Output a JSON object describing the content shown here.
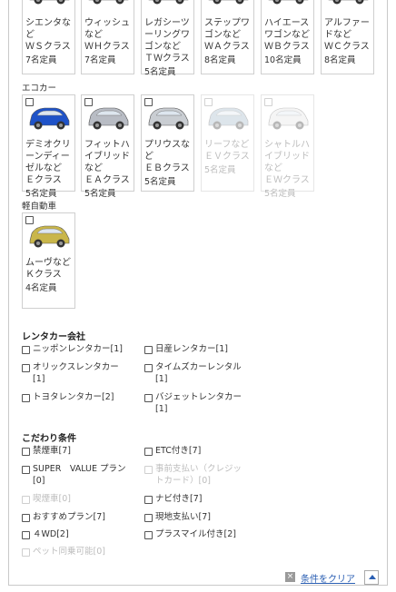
{
  "cards_row1": [
    {
      "text": "シエンタな\nど\nＷＳクラス",
      "cap": "7名定員",
      "color": "#e8e8e8"
    },
    {
      "text": "ウィッシュ\nなど\nＷＨクラス",
      "cap": "7名定員",
      "color": "#e8e8e8"
    },
    {
      "text": "レガシーツ\nーリングワ\nゴンなど\nＴＷクラス",
      "cap": "5名定員",
      "color": "#e8e8e8"
    },
    {
      "text": "ステップワ\nゴンなど\nＷＡクラス",
      "cap": "8名定員",
      "color": "#e8e8e8"
    },
    {
      "text": "ハイエース\nワゴンなど\nＷＢクラス",
      "cap": "10名定員",
      "color": "#e8e8e8"
    },
    {
      "text": "アルファー\nドなど\nＷＣクラス",
      "cap": "8名定員",
      "color": "#e8e8e8"
    }
  ],
  "eco": {
    "label": "エコカー",
    "cards": [
      {
        "text": "デミオクリ\nーンディー\nゼルなど\nＥクラス",
        "cap": "5名定員",
        "color": "#1f53c8",
        "disabled": false
      },
      {
        "text": "フィットハ\nイブリッド\nなど\nＥＡクラス",
        "cap": "5名定員",
        "color": "#b8bcc4",
        "disabled": false
      },
      {
        "text": "プリウスな\nど\nＥＢクラス",
        "cap": "5名定員",
        "color": "#c9cdd2",
        "disabled": false
      },
      {
        "text": "リーフなど\nＥＶクラス",
        "cap": "5名定員",
        "color": "#9fb6c8",
        "disabled": true
      },
      {
        "text": "シャトルハ\nイブリッド\nなど\nＥＷクラス",
        "cap": "5名定員",
        "color": "#e4e4e4",
        "disabled": true
      }
    ]
  },
  "kei": {
    "label": "軽自動車",
    "cards": [
      {
        "text": "ムーヴなど\nＫクラス",
        "cap": "4名定員",
        "color": "#c9b64a",
        "disabled": false
      }
    ]
  },
  "rental": {
    "title": "レンタカー会社",
    "options": [
      {
        "label": "ニッポンレンタカー[1]",
        "disabled": false
      },
      {
        "label": "日産レンタカー[1]",
        "disabled": false
      },
      {
        "label": "オリックスレンタカー\n[1]",
        "disabled": false
      },
      {
        "label": "タイムズカーレンタル\n[1]",
        "disabled": false
      },
      {
        "label": "トヨタレンタカー[2]",
        "disabled": false
      },
      {
        "label": "バジェットレンタカー\n[1]",
        "disabled": false
      }
    ]
  },
  "conditions": {
    "title": "こだわり条件",
    "options": [
      {
        "label": "禁煙車[7]",
        "disabled": false
      },
      {
        "label": "ETC付き[7]",
        "disabled": false
      },
      {
        "label": "SUPER　VALUE プラン\n[0]",
        "disabled": false
      },
      {
        "label": "事前支払い（クレジッ\nトカード）[0]",
        "disabled": true
      },
      {
        "label": "喫煙車[0]",
        "disabled": true
      },
      {
        "label": "ナビ付き[7]",
        "disabled": false
      },
      {
        "label": "おすすめプラン[7]",
        "disabled": false
      },
      {
        "label": "現地支払い[7]",
        "disabled": false
      },
      {
        "label": "４WD[2]",
        "disabled": false
      },
      {
        "label": "プラスマイル付き[2]",
        "disabled": false
      },
      {
        "label": "ペット同乗可能[0]",
        "disabled": true
      }
    ]
  },
  "footer": {
    "clear_icon": "×",
    "clear_label": "条件をクリア",
    "top_icon": "arrow-up-icon"
  }
}
